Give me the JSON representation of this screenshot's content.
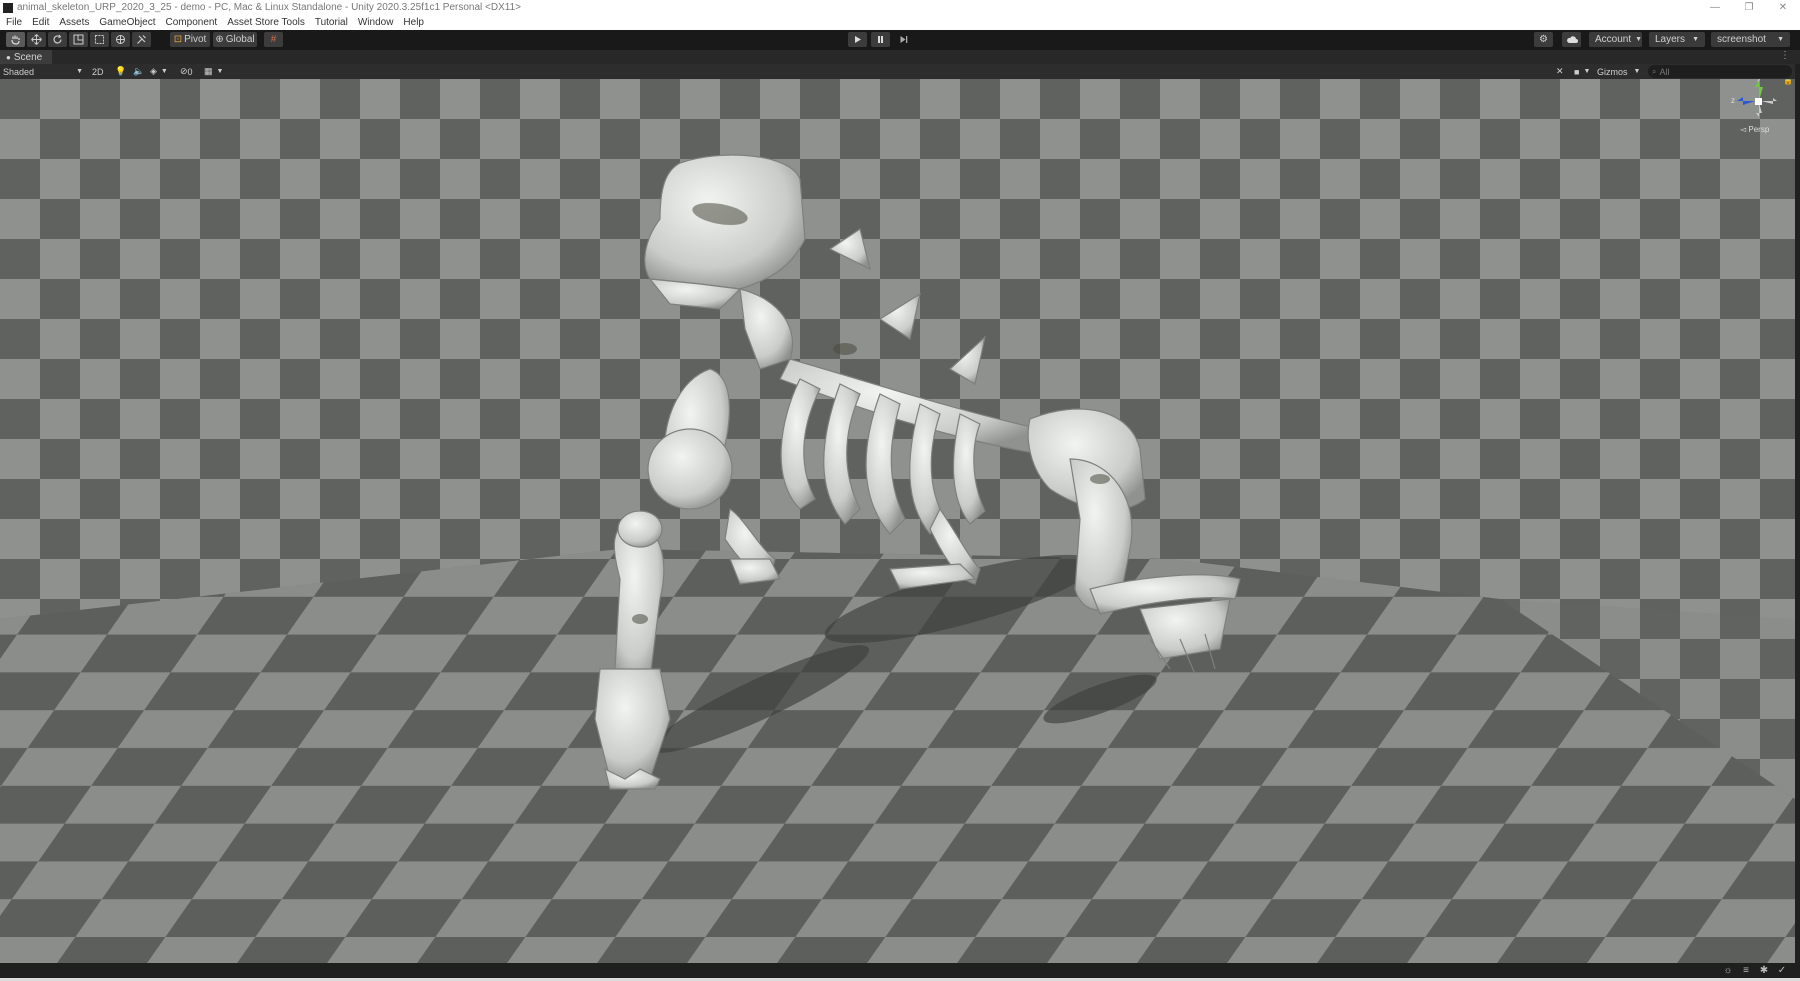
{
  "window": {
    "title": "animal_skeleton_URP_2020_3_25 - demo - PC, Mac & Linux Standalone - Unity 2020.3.25f1c1 Personal <DX11>",
    "minimize": "—",
    "maximize": "❐",
    "close": "✕"
  },
  "menu": [
    "File",
    "Edit",
    "Assets",
    "GameObject",
    "Component",
    "Asset Store Tools",
    "Tutorial",
    "Window",
    "Help"
  ],
  "toolbar": {
    "tools": [
      "hand-tool-icon",
      "move-tool-icon",
      "rotate-tool-icon",
      "scale-tool-icon",
      "rect-tool-icon",
      "transform-tool-icon",
      "custom-tool-icon"
    ],
    "pivot_label": "Pivot",
    "global_label": "Global",
    "account_label": "Account",
    "layers_label": "Layers",
    "layout_label": "screenshot"
  },
  "tab": {
    "label": "Scene"
  },
  "scene_toolbar": {
    "draw_mode": "Shaded",
    "mode_2d": "2D",
    "hidden_count": "0",
    "gizmos_label": "Gizmos",
    "search_placeholder": "All"
  },
  "gizmo": {
    "y": "y",
    "z": "z",
    "projection": "Persp"
  },
  "colors": {
    "viewport_bg": "#6a6d69",
    "checker_light": "#8f9390",
    "checker_dark": "#5e615e",
    "accent_active": "#5a5a5a"
  }
}
